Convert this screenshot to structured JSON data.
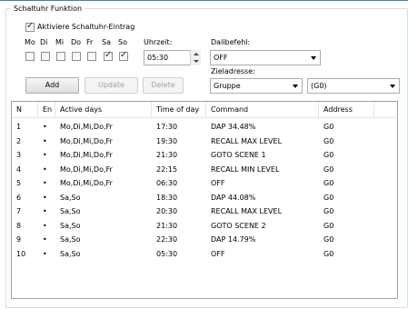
{
  "group_title": "Schaltuhr Funktion",
  "activate_label": "Aktiviere Schaltuhr-Eintrag",
  "activate_checked": true,
  "days": [
    {
      "label": "Mo",
      "checked": false
    },
    {
      "label": "Di",
      "checked": false
    },
    {
      "label": "Mi",
      "checked": false
    },
    {
      "label": "Do",
      "checked": false
    },
    {
      "label": "Fr",
      "checked": false
    },
    {
      "label": "Sa",
      "checked": true
    },
    {
      "label": "So",
      "checked": true
    }
  ],
  "time": {
    "label": "Uhrzeit:",
    "value": "05:30"
  },
  "dali_command": {
    "label": "Dalibefehl:",
    "value": "OFF"
  },
  "target": {
    "label": "Zieladresse:",
    "type_value": "Gruppe",
    "address_value": "(G0)"
  },
  "buttons": {
    "add": "Add",
    "update": "Update",
    "delete": "Delete"
  },
  "table": {
    "columns": [
      "N",
      "En",
      "Active days",
      "Time of day",
      "Command",
      "Address"
    ],
    "rows": [
      {
        "n": "1",
        "en": "•",
        "days": "Mo,Di,Mi,Do,Fr",
        "time": "17:30",
        "command": "DAP 34.48%",
        "address": "G0"
      },
      {
        "n": "2",
        "en": "•",
        "days": "Mo,Di,Mi,Do,Fr",
        "time": "19:30",
        "command": "RECALL MAX LEVEL",
        "address": "G0"
      },
      {
        "n": "3",
        "en": "•",
        "days": "Mo,Di,Mi,Do,Fr",
        "time": "21:30",
        "command": "GOTO SCENE 1",
        "address": "G0"
      },
      {
        "n": "4",
        "en": "•",
        "days": "Mo,Di,Mi,Do,Fr",
        "time": "22:15",
        "command": "RECALL MIN LEVEL",
        "address": "G0"
      },
      {
        "n": "5",
        "en": "•",
        "days": "Mo,Di,Mi,Do,Fr",
        "time": "06:30",
        "command": "OFF",
        "address": "G0"
      },
      {
        "n": "6",
        "en": "•",
        "days": "Sa,So",
        "time": "18:30",
        "command": "DAP 44.08%",
        "address": "G0"
      },
      {
        "n": "7",
        "en": "•",
        "days": "Sa,So",
        "time": "20:30",
        "command": "RECALL MAX LEVEL",
        "address": "G0"
      },
      {
        "n": "8",
        "en": "•",
        "days": "Sa,So",
        "time": "21:30",
        "command": "GOTO SCENE 2",
        "address": "G0"
      },
      {
        "n": "9",
        "en": "•",
        "days": "Sa,So",
        "time": "22:30",
        "command": "DAP 14.79%",
        "address": "G0"
      },
      {
        "n": "10",
        "en": "•",
        "days": "Sa,So",
        "time": "05:30",
        "command": "OFF",
        "address": "G0"
      }
    ]
  },
  "colors": {
    "accent": "#3c7fb1",
    "check": "#21364e"
  }
}
